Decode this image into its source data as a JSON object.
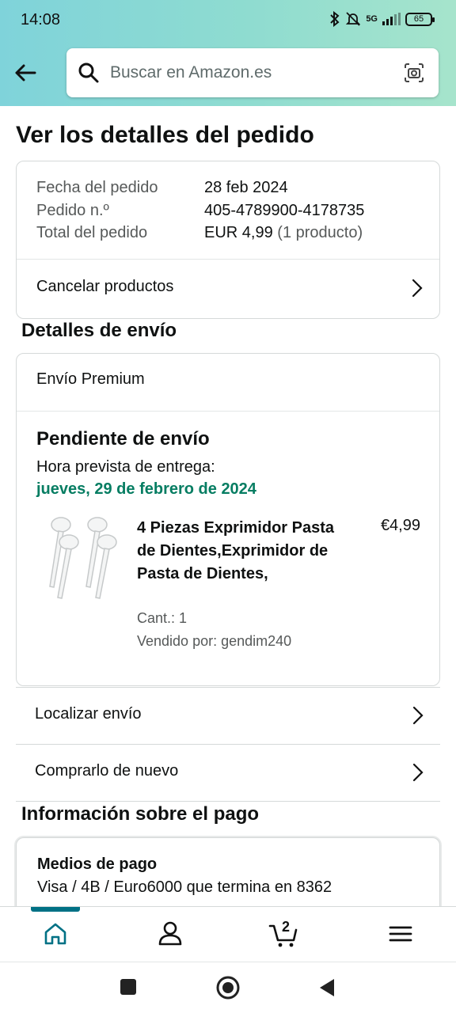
{
  "status_bar": {
    "time": "14:08",
    "network": "5G",
    "battery": "65"
  },
  "search": {
    "placeholder": "Buscar en Amazon.es"
  },
  "page_title": "Ver los detalles del pedido",
  "order_summary": {
    "date_label": "Fecha del pedido",
    "date_value": "28 feb 2024",
    "number_label": "Pedido n.º",
    "number_value": "405-4789900-4178735",
    "total_label": "Total del pedido",
    "total_value": "EUR 4,99",
    "total_count": "(1 producto)",
    "cancel_label": "Cancelar productos"
  },
  "shipping": {
    "section_title": "Detalles de envío",
    "method": "Envío Premium",
    "status": "Pendiente de envío",
    "eta_label": "Hora prevista de entrega:",
    "eta_date": "jueves, 29 de febrero de 2024",
    "product": {
      "name": "4 Piezas Exprimidor Pasta de Dientes,Exprimidor de Pasta de Dientes,",
      "price": "€4,99",
      "quantity": "Cant.: 1",
      "seller": "Vendido por: gendim240"
    },
    "track_label": "Localizar envío",
    "reorder_label": "Comprarlo de nuevo"
  },
  "payment": {
    "section_title": "Información sobre el pago",
    "method_title": "Medios de pago",
    "method_value": "Visa / 4B / Euro6000  que termina en 8362"
  },
  "bottom_nav": {
    "cart_count": "2",
    "active": "home"
  },
  "colors": {
    "accent": "#007185",
    "delivery_green": "#067d62",
    "header_gradient_start": "#7fd3da",
    "header_gradient_end": "#a6e4cc"
  }
}
